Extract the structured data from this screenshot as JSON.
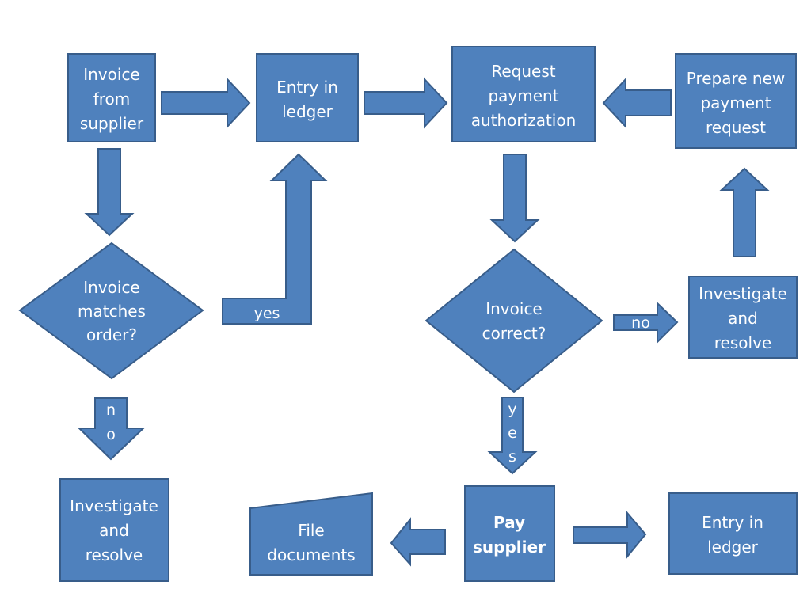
{
  "colors": {
    "shape_fill": "#4F81BD",
    "shape_stroke": "#385D8A",
    "text": "#FFFFFF",
    "background": "#FFFFFF"
  },
  "nodes": {
    "invoice_from_supplier": {
      "type": "process",
      "lines": [
        "Invoice",
        "from",
        "supplier"
      ]
    },
    "entry_in_ledger_1": {
      "type": "process",
      "lines": [
        "Entry in",
        "ledger"
      ]
    },
    "request_payment_authorization": {
      "type": "process",
      "lines": [
        "Request",
        "payment",
        "authorization"
      ]
    },
    "prepare_new_payment_request": {
      "type": "process",
      "lines": [
        "Prepare new",
        "payment",
        "request"
      ]
    },
    "invoice_matches_order": {
      "type": "decision",
      "lines": [
        "Invoice",
        "matches",
        "order?"
      ]
    },
    "invoice_correct": {
      "type": "decision",
      "lines": [
        "Invoice",
        "correct?"
      ]
    },
    "investigate_and_resolve_right": {
      "type": "process",
      "lines": [
        "Investigate",
        "and",
        "resolve"
      ]
    },
    "investigate_and_resolve_left": {
      "type": "process",
      "lines": [
        "Investigate",
        "and",
        "resolve"
      ]
    },
    "file_documents": {
      "type": "manual-input",
      "lines": [
        "File",
        "documents"
      ]
    },
    "pay_supplier": {
      "type": "process",
      "bold": true,
      "lines": [
        "Pay",
        "supplier"
      ]
    },
    "entry_in_ledger_2": {
      "type": "process",
      "lines": [
        "Entry in",
        "ledger"
      ]
    }
  },
  "edges": [
    {
      "from": "invoice_from_supplier",
      "to": "entry_in_ledger_1",
      "label": ""
    },
    {
      "from": "entry_in_ledger_1",
      "to": "request_payment_authorization",
      "label": ""
    },
    {
      "from": "prepare_new_payment_request",
      "to": "request_payment_authorization",
      "label": ""
    },
    {
      "from": "invoice_from_supplier",
      "to": "invoice_matches_order",
      "label": ""
    },
    {
      "from": "invoice_matches_order",
      "to": "entry_in_ledger_1",
      "label": "yes"
    },
    {
      "from": "invoice_matches_order",
      "to": "investigate_and_resolve_left",
      "label": "no",
      "label_chars": [
        "n",
        "o"
      ]
    },
    {
      "from": "request_payment_authorization",
      "to": "invoice_correct",
      "label": ""
    },
    {
      "from": "invoice_correct",
      "to": "investigate_and_resolve_right",
      "label": "no"
    },
    {
      "from": "investigate_and_resolve_right",
      "to": "prepare_new_payment_request",
      "label": ""
    },
    {
      "from": "invoice_correct",
      "to": "pay_supplier",
      "label": "yes",
      "label_chars": [
        "y",
        "e",
        "s"
      ]
    },
    {
      "from": "pay_supplier",
      "to": "file_documents",
      "label": ""
    },
    {
      "from": "pay_supplier",
      "to": "entry_in_ledger_2",
      "label": ""
    }
  ]
}
